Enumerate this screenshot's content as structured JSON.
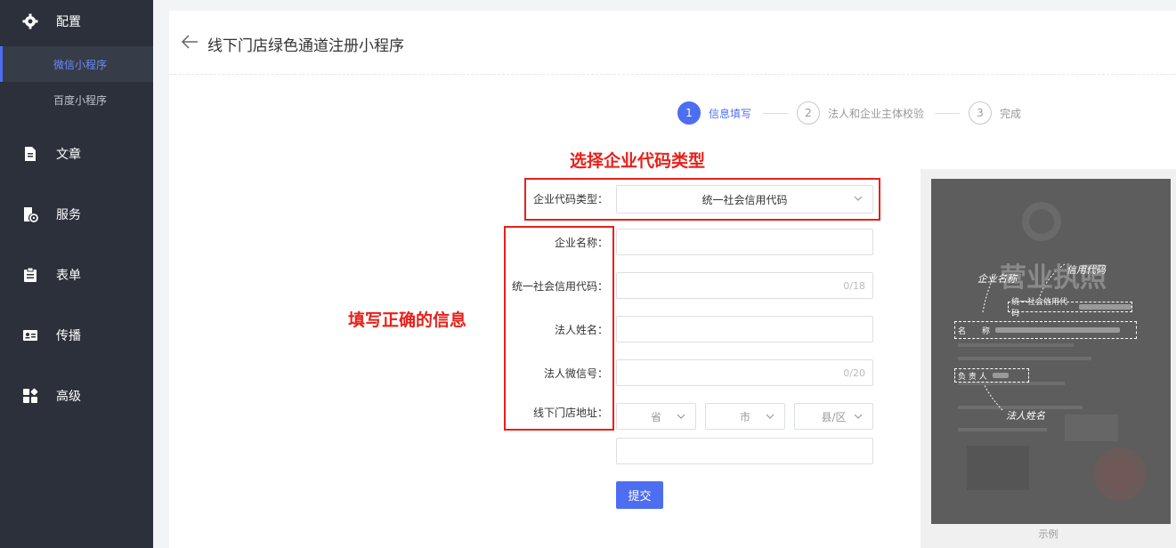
{
  "sidebar": {
    "items": [
      {
        "label": "配置",
        "icon": "gear-icon"
      },
      {
        "label": "文章",
        "icon": "document-icon"
      },
      {
        "label": "服务",
        "icon": "service-icon"
      },
      {
        "label": "表单",
        "icon": "clipboard-icon"
      },
      {
        "label": "传播",
        "icon": "id-card-icon"
      },
      {
        "label": "高级",
        "icon": "grid-icon"
      }
    ],
    "sub_items": [
      {
        "label": "微信小程序",
        "active": true
      },
      {
        "label": "百度小程序",
        "active": false
      }
    ],
    "accent_color": "#4e6ef2"
  },
  "header": {
    "title": "线下门店绿色通道注册小程序"
  },
  "steps": [
    {
      "num": "1",
      "label": "信息填写",
      "active": true
    },
    {
      "num": "2",
      "label": "法人和企业主体校验",
      "active": false
    },
    {
      "num": "3",
      "label": "完成",
      "active": false
    }
  ],
  "form": {
    "code_type_label": "企业代码类型：",
    "code_type_value": "统一社会信用代码",
    "name_label": "企业名称：",
    "credit_code_label": "统一社会信用代码：",
    "credit_code_counter": "0/18",
    "legal_name_label": "法人姓名：",
    "legal_wechat_label": "法人微信号：",
    "legal_wechat_counter": "0/20",
    "address_label": "线下门店地址：",
    "province_placeholder": "省",
    "city_placeholder": "市",
    "district_placeholder": "县/区",
    "submit_label": "提交"
  },
  "annotations": {
    "select_code_type": "选择企业代码类型",
    "fill_correct_info": "填写正确的信息"
  },
  "sample": {
    "caption": "示例",
    "license_title": "营业执照",
    "credit_code_field": "统一社会信用代码",
    "name_field": "名　　称",
    "owner_field": "负 责 人",
    "note_company_name": "企业名称",
    "note_credit_code": "信用代码",
    "note_legal_name": "法人姓名"
  }
}
